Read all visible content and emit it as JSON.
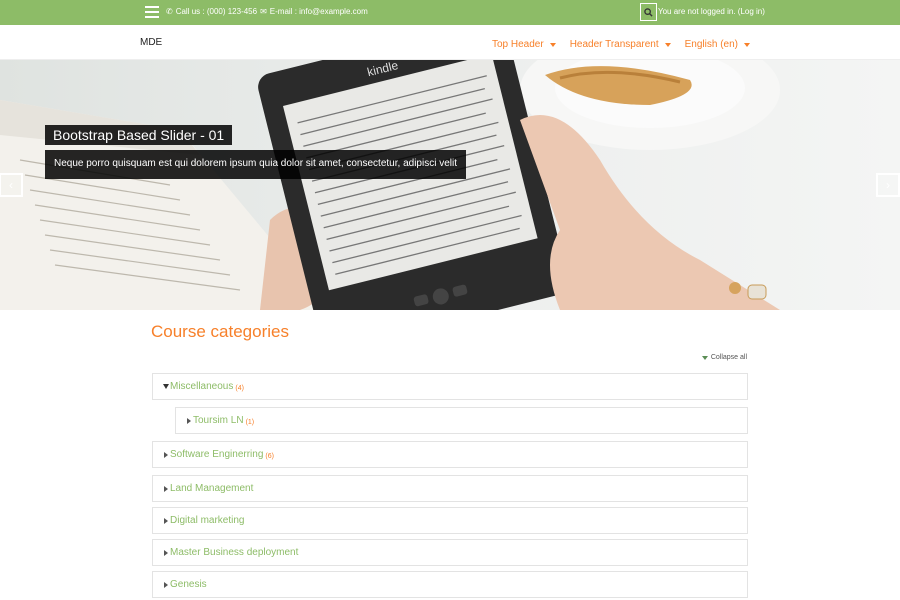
{
  "topbar": {
    "call_label": "Call us : (000) 123-456",
    "email_label": "E-mail : info@example.com",
    "login_text": "You are not logged in.",
    "login_link": "(Log in)"
  },
  "header": {
    "brand": "MDE",
    "nav": [
      {
        "label": "Top Header"
      },
      {
        "label": "Header Transparent"
      },
      {
        "label": "English (en)"
      }
    ]
  },
  "slider": {
    "title": "Bootstrap Based Slider - 01",
    "text": "Neque porro quisquam est qui dolorem ipsum quia dolor sit amet, consectetur, adipisci velit",
    "prev_icon": "chevron-left-icon",
    "next_icon": "chevron-right-icon",
    "device_brand": "kindle"
  },
  "main": {
    "title": "Course categories",
    "collapse_label": "Collapse all",
    "categories": [
      {
        "name": "Miscellaneous",
        "count": "(4)",
        "expanded": true
      },
      {
        "name": "Toursim LN",
        "count": "(1)",
        "sub": true
      },
      {
        "name": "Software Enginerring",
        "count": "(6)"
      },
      {
        "name": "Land Management",
        "count": ""
      },
      {
        "name": "Digital marketing",
        "count": ""
      },
      {
        "name": "Master Business deployment",
        "count": ""
      },
      {
        "name": "Genesis",
        "count": ""
      }
    ]
  },
  "colors": {
    "accent_green": "#8dbc67",
    "accent_orange": "#f7802a"
  }
}
